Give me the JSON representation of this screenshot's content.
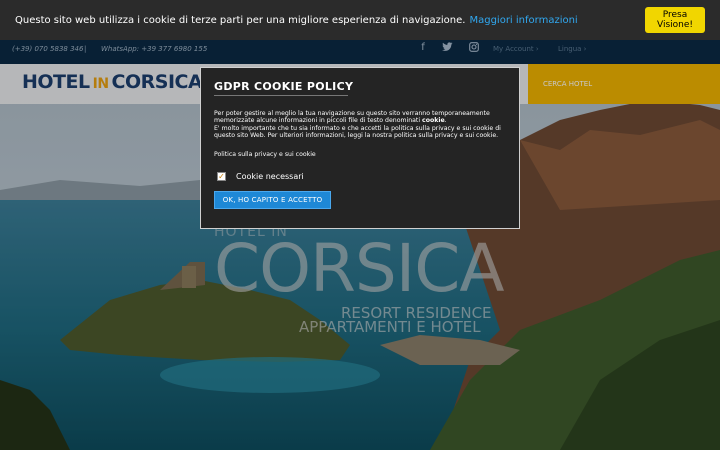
{
  "cookie_bar": {
    "message": "Questo sito web utilizza i cookie di terze parti per una migliore esperienza di navigazione.",
    "more_link": "Maggiori informazioni",
    "ok_button": "Presa Visione!"
  },
  "topnav": {
    "phone": "(+39) 070 5838 346",
    "separator": "|",
    "whatsapp": "WhatsApp: +39 377 6980 155",
    "social": [
      {
        "icon": "facebook-icon",
        "glyph": "f"
      },
      {
        "icon": "twitter-icon",
        "glyph": "🐦"
      },
      {
        "icon": "instagram-icon",
        "glyph": "◙"
      }
    ],
    "account": "My Account ›",
    "language": "Lingua ›"
  },
  "header": {
    "logo_word1": "HOTEL",
    "logo_word2": "IN",
    "logo_word3": "CORSICA",
    "cerca": "CERCA HOTEL",
    "arrow": "›"
  },
  "hero": {
    "pretitle": "HOTEL IN",
    "title": "CORSICA",
    "subtitle1": "RESORT RESIDENCE",
    "subtitle2": "APPARTAMENTI E HOTEL"
  },
  "modal": {
    "title": "GDPR COOKIE POLICY",
    "body_line1": "Per poter gestire al meglio la tua navigazione su questo sito verranno temporaneamente",
    "body_line2a": "memorizzate alcune informazioni in piccoli file di testo denominati ",
    "body_bold": "cookie",
    "body_line2b": ".",
    "body_line3": "E' molto importante che tu sia informato e che accetti la politica sulla privacy e sui cookie di",
    "body_line4": "questo sito Web. Per ulteriori informazioni, leggi la nostra politica sulla privacy e sui cookie.",
    "policy_link": "Politica sulla privacy e sui cookie",
    "checkbox_label": "Cookie necessari",
    "checkbox_mark": "✓",
    "accept_button": "OK, HO CAPITO E ACCETTO"
  },
  "colors": {
    "cookie_bar_bg": "#2b2b2b",
    "link_blue": "#31a8f0",
    "ok_yellow": "#f1d600",
    "topnav_bg": "#0b2a44",
    "brand_blue": "#1b3e6e",
    "brand_orange": "#e8a013",
    "cta_yellow": "#f0b400",
    "accept_blue": "#1e88d6"
  }
}
